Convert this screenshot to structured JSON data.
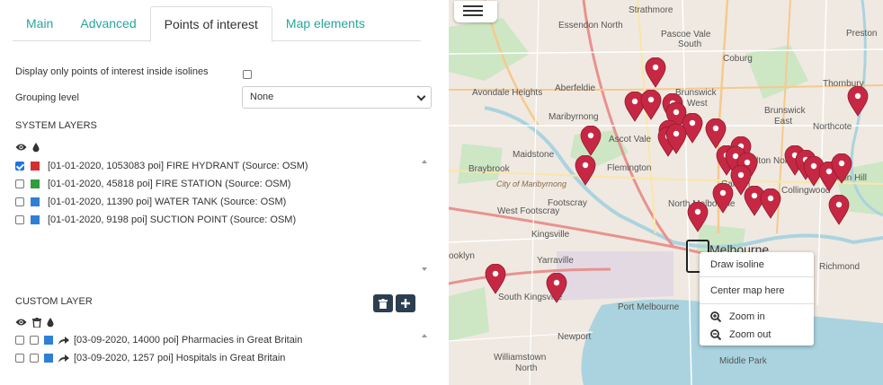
{
  "tabs": [
    {
      "label": "Main"
    },
    {
      "label": "Advanced"
    },
    {
      "label": "Points of interest"
    },
    {
      "label": "Map elements"
    }
  ],
  "options": {
    "inside_isolines_label": "Display only points of interest inside isolines",
    "grouping_label": "Grouping level",
    "grouping_value": "None"
  },
  "system_layers": {
    "title": "SYSTEM LAYERS",
    "items": [
      {
        "label": "[01-01-2020, 1053083 poi] FIRE HYDRANT (Source: OSM)",
        "checked": true,
        "color": "#d32f2f"
      },
      {
        "label": "[01-01-2020, 45818 poi] FIRE STATION (Source: OSM)",
        "checked": false,
        "color": "#2e9e3e"
      },
      {
        "label": "[01-01-2020, 11390 poi] WATER TANK (Source: OSM)",
        "checked": false,
        "color": "#2f7fd6"
      },
      {
        "label": "[01-01-2020, 9198 poi] SUCTION POINT (Source: OSM)",
        "checked": false,
        "color": "#2f7fd6"
      }
    ]
  },
  "custom_layer": {
    "title": "CUSTOM LAYER",
    "items": [
      {
        "label": "[03-09-2020, 14000 poi] Pharmacies in Great Britain",
        "color": "#2f7fd6"
      },
      {
        "label": "[03-09-2020, 1257 poi] Hospitals in Great Britain",
        "color": "#2f7fd6"
      }
    ]
  },
  "map_labels": [
    "Strathmore",
    "Pascoe Vale",
    "South",
    "Essendon North",
    "Coburg",
    "Preston",
    "Thornbury",
    "Avondale Heights",
    "Aberfeldie",
    "Brunswick",
    "West",
    "Brunswick",
    "East",
    "Maribyrnong",
    "Northcote",
    "Ascot Vale",
    "Maidstone",
    "Flemington",
    "Carlton North",
    "Braybrook",
    "City of Maribyrnong",
    "Carlton",
    "Clifton Hill",
    "West Footscray",
    "Footscray",
    "North Melbourne",
    "Collingwood",
    "Kingsville",
    "Yarraville",
    "Melbourne",
    "Richmond",
    "ooklyn",
    "South Kingsville",
    "Port Melbourne",
    "Newport",
    "Williamstown",
    "North",
    "Middle Park"
  ],
  "context_menu": {
    "draw_isoline": "Draw isoline",
    "center_map": "Center map here",
    "zoom_in": "Zoom in",
    "zoom_out": "Zoom out"
  },
  "colors": {
    "accent": "#26a69a",
    "pin": "#c62844",
    "dark_button": "#2c3e50",
    "checkbox_blue": "#1a73e8"
  }
}
